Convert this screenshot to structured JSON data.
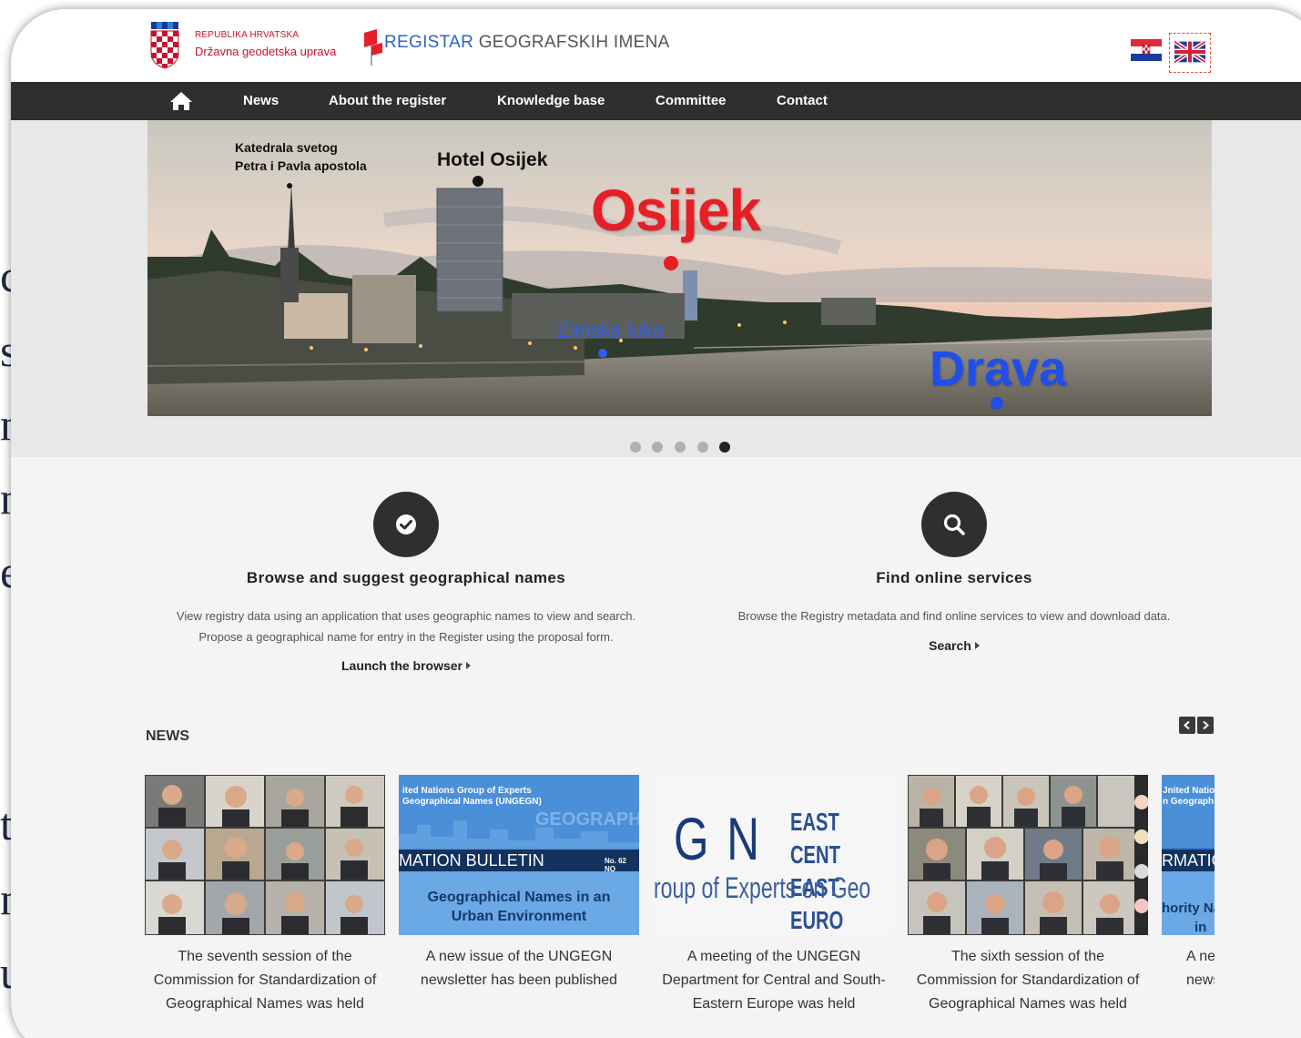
{
  "background_slide": {
    "letters": [
      "c",
      "s",
      "n",
      "n",
      "e",
      "t",
      "n",
      "u"
    ]
  },
  "header": {
    "org_line1": "REPUBLIKA HRVATSKA",
    "org_line2": "Državna geodetska uprava",
    "register_title_highlight": "REGISTAR",
    "register_title_rest": " GEOGRAFSKIH IMENA",
    "languages": [
      "hr-flag-icon",
      "uk-flag-icon"
    ]
  },
  "nav": {
    "home_icon": "home-icon",
    "items": [
      {
        "label": "News"
      },
      {
        "label": "About the register"
      },
      {
        "label": "Knowledge base"
      },
      {
        "label": "Committee"
      },
      {
        "label": "Contact"
      }
    ]
  },
  "hero": {
    "labels": {
      "katedrala_line1": "Katedrala svetog",
      "katedrala_line2": "Petra i Pavla apostola",
      "hotel": "Hotel Osijek",
      "city": "Osijek",
      "zimska": "Zimska luka",
      "river": "Drava"
    },
    "slides": 5,
    "active_slide": 5
  },
  "services": [
    {
      "icon": "check-circle-icon",
      "title": "Browse and suggest geographical names",
      "line1": "View registry data using an application that uses geographic names to view and search.",
      "line2": "Propose a geographical name for entry in the Register using the proposal form.",
      "link": "Launch the browser"
    },
    {
      "icon": "search-icon",
      "title": "Find online services",
      "line1": "Browse the Registry metadata and find online services to view and download data.",
      "link": "Search"
    }
  ],
  "news": {
    "heading": "NEWS",
    "items": [
      {
        "line1": "The seventh session of the",
        "line2": "Commission for Standardization of",
        "line3": "Geographical Names was held"
      },
      {
        "line1": "A new issue of the UNGEGN",
        "line2": "newsletter has been published",
        "thumb": {
          "org1": "ited Nations Group of Experts",
          "org2": "Geographical Names (UNGEGN)",
          "bulletin": "MATION BULLETIN",
          "issue": "No. 62 NO",
          "theme1": "Geographical Names in an",
          "theme2": "Urban Environment",
          "watermark": "GEOGRAPH"
        }
      },
      {
        "line1": "A meeting of the UNGEGN",
        "line2": "Department for Central and South-",
        "line3": "Eastern Europe was held",
        "thumb": {
          "big": "G N",
          "east1": "EAST CENT",
          "east2": "EAST EURO",
          "group": "roup of Experts on Geo"
        }
      },
      {
        "line1": "The sixth session of the",
        "line2": "Commission for Standardization of",
        "line3": "Geographical Names was held"
      },
      {
        "line1": "A ne",
        "line2": "news",
        "thumb": {
          "org1": "Jnited Natio",
          "org2": "n Geograph",
          "bulletin": "RMATIO",
          "theme1": "hority Na",
          "theme2": "in"
        }
      }
    ]
  }
}
